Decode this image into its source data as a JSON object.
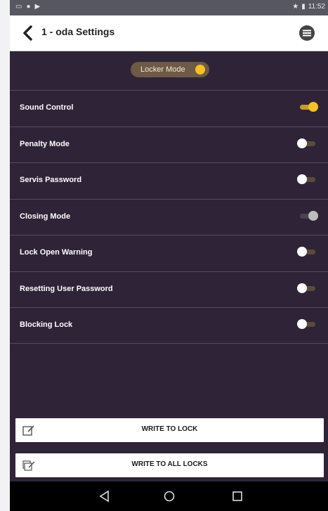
{
  "status_bar": {
    "left_icons": [
      "image-icon",
      "location-icon",
      "play-store-icon"
    ],
    "time": "11:52",
    "right_icons": [
      "bluetooth-icon",
      "battery-icon"
    ]
  },
  "app_bar": {
    "title": "1 - oda Settings"
  },
  "locker_mode": {
    "label": "Locker Mode",
    "state": "on",
    "accent": "#f6c21c"
  },
  "settings": [
    {
      "label": "Sound Control",
      "state": "on"
    },
    {
      "label": "Penalty Mode",
      "state": "off"
    },
    {
      "label": "Servis Password",
      "state": "off"
    },
    {
      "label": "Closing Mode",
      "state": "disabled"
    },
    {
      "label": "Lock Open Warning",
      "state": "off"
    },
    {
      "label": "Resetting User Password",
      "state": "off"
    },
    {
      "label": "Blocking Lock",
      "state": "off"
    }
  ],
  "actions": {
    "write_to_lock": "WRITE TO LOCK",
    "write_to_all_locks": "WRITE TO ALL LOCKS"
  },
  "colors": {
    "background": "#2f2437",
    "toggle_on": "#f6c21c",
    "app_bar": "#ffffff"
  }
}
